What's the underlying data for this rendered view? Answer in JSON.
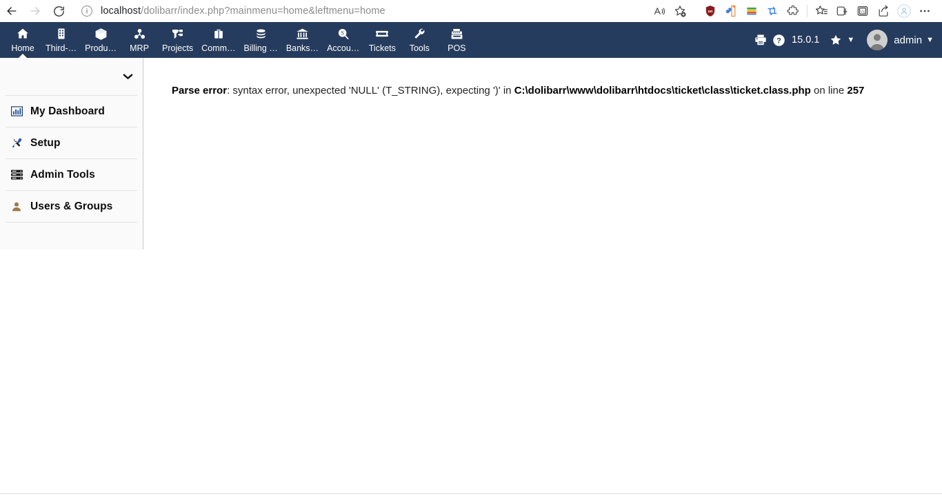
{
  "browser": {
    "back_label": "Back",
    "forward_label": "Forward",
    "reload_label": "Refresh",
    "site_info_label": "View site information",
    "url_host": "localhost",
    "url_path": "/dolibarr/index.php?mainmenu=home&leftmenu=home",
    "url_full": "localhost/dolibarr/index.php?mainmenu=home&leftmenu=home",
    "toolbar_icons": [
      {
        "name": "read-aloud-icon",
        "glyph": "A"
      },
      {
        "name": "add-favorite-icon",
        "glyph": "star"
      },
      {
        "name": "ublock-origin-extension-icon",
        "glyph": "shield"
      },
      {
        "name": "extension-colorpick-icon",
        "glyph": "pin"
      },
      {
        "name": "extension-stripe-icon",
        "glyph": "bars"
      },
      {
        "name": "extension-sync-icon",
        "glyph": "loop"
      },
      {
        "name": "extensions-puzzle-icon",
        "glyph": "puzzle"
      },
      {
        "name": "favorites-icon",
        "glyph": "star-list"
      },
      {
        "name": "collections-icon",
        "glyph": "collections"
      },
      {
        "name": "browser-essentials-icon",
        "glyph": "essentials"
      },
      {
        "name": "share-icon",
        "glyph": "share"
      },
      {
        "name": "profile-icon",
        "glyph": "person"
      },
      {
        "name": "settings-and-more-icon",
        "glyph": "ellipsis"
      }
    ]
  },
  "topmenu": {
    "items": [
      {
        "label": "Home",
        "icon": "home-icon",
        "active": true
      },
      {
        "label": "Third-…",
        "icon": "building-icon",
        "active": false
      },
      {
        "label": "Produ…",
        "icon": "box-icon",
        "active": false
      },
      {
        "label": "MRP",
        "icon": "mrp-icon",
        "active": false
      },
      {
        "label": "Projects",
        "icon": "project-icon",
        "active": false
      },
      {
        "label": "Comm…",
        "icon": "briefcase-icon",
        "active": false
      },
      {
        "label": "Billing …",
        "icon": "coins-icon",
        "active": false
      },
      {
        "label": "Banks…",
        "icon": "bank-icon",
        "active": false
      },
      {
        "label": "Accou…",
        "icon": "accounting-search-icon",
        "active": false
      },
      {
        "label": "Tickets",
        "icon": "ticket-icon",
        "active": false
      },
      {
        "label": "Tools",
        "icon": "wrench-icon",
        "active": false
      },
      {
        "label": "POS",
        "icon": "cash-register-icon",
        "active": false
      }
    ],
    "print_label": "Print",
    "help_label": "Help",
    "version": "15.0.1",
    "bookmark_label": "Bookmarks",
    "user_name": "admin"
  },
  "sidebar": {
    "items": [
      {
        "label": "My Dashboard",
        "icon": "bar-chart-icon"
      },
      {
        "label": "Setup",
        "icon": "tools-icon"
      },
      {
        "label": "Admin Tools",
        "icon": "server-icon"
      },
      {
        "label": "Users & Groups",
        "icon": "user-icon"
      }
    ]
  },
  "main": {
    "error": {
      "prefix": "Parse error",
      "message": ": syntax error, unexpected 'NULL' (T_STRING), expecting ')' in ",
      "file": "C:\\dolibarr\\www\\dolibarr\\htdocs\\ticket\\class\\ticket.class.php",
      "middle": " on line ",
      "line": "257"
    }
  },
  "colors": {
    "navbar": "#263c5e",
    "sidebar_bg": "#fafafa",
    "content_bg": "#ffffff",
    "accent_white": "#ffffff"
  }
}
